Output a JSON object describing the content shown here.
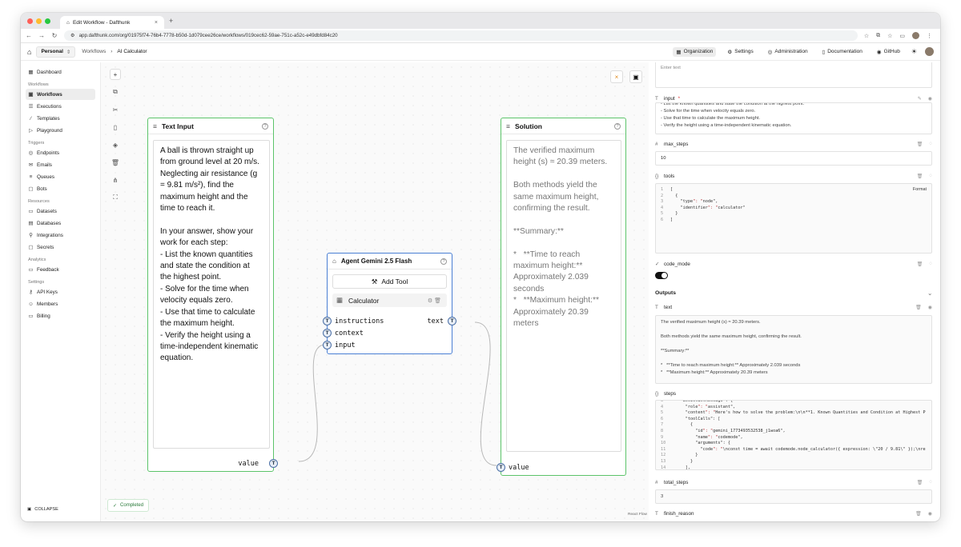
{
  "browser": {
    "tab_title": "Edit Workflow - Dafthunk",
    "url": "app.dafthunk.com/org/01975f74-76b4-7778-b50d-1d079cee26ce/workflows/019cec62-59ae-751c-a52c-e49dbfd84c20"
  },
  "header": {
    "org": "Personal",
    "breadcrumb_parent": "Workflows",
    "breadcrumb_current": "AI Calculator",
    "links": [
      "Organization",
      "Settings",
      "Administration",
      "Documentation",
      "GitHub"
    ]
  },
  "sidebar": {
    "top": [
      "Dashboard"
    ],
    "workflows_label": "Workflows",
    "workflows": [
      "Workflows",
      "Executions",
      "Templates",
      "Playground"
    ],
    "triggers_label": "Triggers",
    "triggers": [
      "Endpoints",
      "Emails",
      "Queues",
      "Bots"
    ],
    "resources_label": "Resources",
    "resources": [
      "Datasets",
      "Databases",
      "Integrations",
      "Secrets"
    ],
    "analytics_label": "Analytics",
    "analytics": [
      "Feedback"
    ],
    "settings_label": "Settings",
    "settings": [
      "API Keys",
      "Members",
      "Billing"
    ],
    "collapse": "COLLAPSE"
  },
  "canvas": {
    "status": "Completed",
    "react_flow": "React Flow"
  },
  "text_input_node": {
    "title": "Text Input",
    "content": "A ball is thrown straight up from ground level at 20 m/s. Neglecting air resistance (g = 9.81 m/s²), find the maximum height and the time to reach it.\n\nIn your answer, show your work for each step:\n- List the known quantities and state the condition at the highest point.\n- Solve for the time when velocity equals zero.\n- Use that time to calculate the maximum height.\n- Verify the height using a time-independent kinematic equation.",
    "output_port": "value"
  },
  "agent_node": {
    "title": "Agent Gemini 2.5 Flash",
    "add_tool": "Add Tool",
    "tool": "Calculator",
    "inputs": [
      "instructions",
      "context",
      "input"
    ],
    "output": "text"
  },
  "solution_node": {
    "title": "Solution",
    "content": "The verified maximum height (s) ≈ 20.39 meters.\n\nBoth methods yield the same maximum height, confirming the result.\n\n**Summary:**\n\n*   **Time to reach maximum height:** Approximately 2.039 seconds\n*   **Maximum height:** Approximately 20.39 meters",
    "input_port": "value"
  },
  "panel": {
    "top_placeholder": "Enter text",
    "input_label": "input",
    "input_required": "*",
    "input_text": "- List the known quantities and state the condition at the highest point.\n- Solve for the time when velocity equals zero.\n- Use that time to calculate the maximum height.\n- Verify the height using a time-independent kinematic equation.",
    "max_steps_label": "max_steps",
    "max_steps_value": "10",
    "tools_label": "tools",
    "tools_format": "Format",
    "tools_code": [
      {
        "n": "1",
        "t": "["
      },
      {
        "n": "2",
        "t": "  {"
      },
      {
        "n": "3",
        "t": "    \"type\": \"node\","
      },
      {
        "n": "4",
        "t": "    \"identifier\": \"calculator\""
      },
      {
        "n": "5",
        "t": "  }"
      },
      {
        "n": "6",
        "t": "]"
      }
    ],
    "code_mode_label": "code_mode",
    "outputs_label": "Outputs",
    "text_label": "text",
    "text_output": "The verified maximum height (s) ≈ 20.39 meters.\n\nBoth methods yield the same maximum height, confirming the result.\n\n**Summary:**\n\n*   **Time to reach maximum height:** Approximately 2.039 seconds\n*   **Maximum height:** Approximately 20.39 meters",
    "steps_label": "steps",
    "steps_code": [
      {
        "n": "3",
        "t": "    \"assistantMessage\": {"
      },
      {
        "n": "4",
        "t": "      \"role\": \"assistant\","
      },
      {
        "n": "5",
        "t": "      \"content\": \"Here's how to solve the problem:\\n\\n**1. Known Quantities and Condition at Highest P"
      },
      {
        "n": "6",
        "t": "      \"toolCalls\": ["
      },
      {
        "n": "7",
        "t": "        {"
      },
      {
        "n": "8",
        "t": "          \"id\": \"gemini_1773493532538_j1woa6\","
      },
      {
        "n": "9",
        "t": "          \"name\": \"codemode\","
      },
      {
        "n": "10",
        "t": "          \"arguments\": {"
      },
      {
        "n": "11",
        "t": "            \"code\": \"\\nconst time = await codemode.node_calculator({ expression: \\\"20 / 9.81\\\" });\\nre"
      },
      {
        "n": "12",
        "t": "          }"
      },
      {
        "n": "13",
        "t": "        }"
      },
      {
        "n": "14",
        "t": "      ],"
      },
      {
        "n": "15",
        "t": "    },"
      }
    ],
    "total_steps_label": "total_steps",
    "total_steps_value": "3",
    "finish_reason_label": "finish_reason"
  },
  "colors": {
    "node_border_green": "#5cc46a",
    "agent_border_blue": "#4a7fd4",
    "edge_grey": "#b8b8b8"
  }
}
